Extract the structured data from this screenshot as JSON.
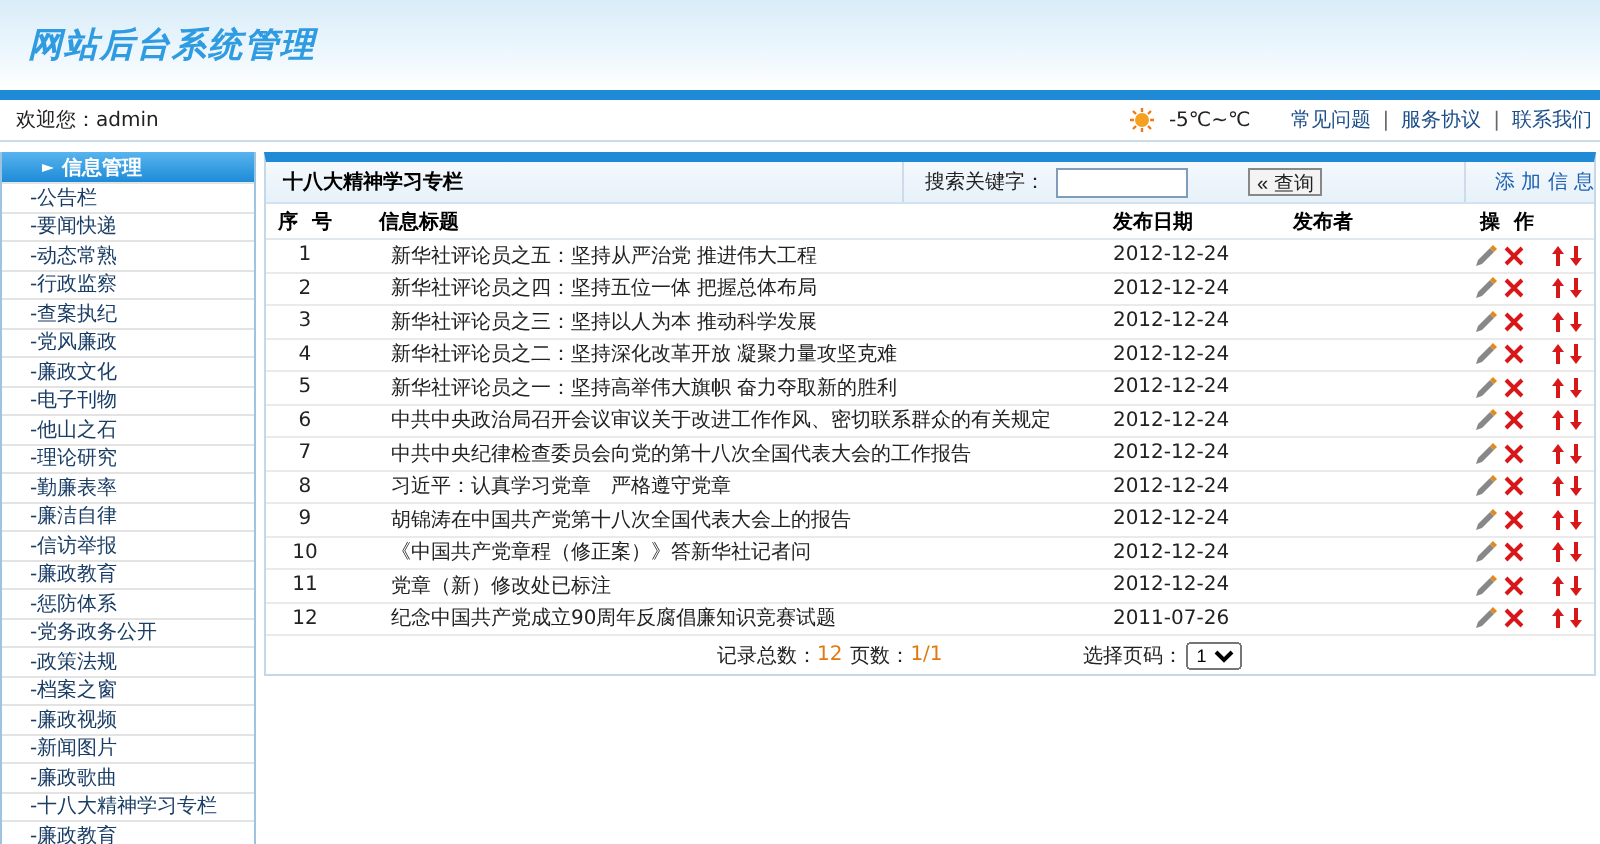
{
  "header": {
    "logo": "网站后台系统管理"
  },
  "topbar": {
    "welcome": "欢迎您：admin",
    "weather": "-5℃~℃",
    "links": [
      "常见问题",
      "服务协议",
      "联系我们"
    ],
    "separator": "|"
  },
  "sidebar": {
    "title": "信息管理",
    "items": [
      {
        "label": "-公告栏"
      },
      {
        "label": "-要闻快递"
      },
      {
        "label": "-动态常熟"
      },
      {
        "label": "-行政监察"
      },
      {
        "label": "-查案执纪"
      },
      {
        "label": "-党风廉政"
      },
      {
        "label": "-廉政文化"
      },
      {
        "label": "-电子刊物"
      },
      {
        "label": "-他山之石"
      },
      {
        "label": "-理论研究"
      },
      {
        "label": "-勤廉表率"
      },
      {
        "label": "-廉洁自律"
      },
      {
        "label": "-信访举报"
      },
      {
        "label": "-廉政教育"
      },
      {
        "label": "-惩防体系"
      },
      {
        "label": "-党务政务公开"
      },
      {
        "label": "-政策法规"
      },
      {
        "label": "-档案之窗"
      },
      {
        "label": "-廉政视频"
      },
      {
        "label": "-新闻图片"
      },
      {
        "label": "-廉政歌曲"
      },
      {
        "label": "-十八大精神学习专栏"
      },
      {
        "label": "-廉政教育"
      }
    ]
  },
  "panel": {
    "title": "十八大精神学习专栏",
    "search_label": "搜索关键字：",
    "search_button": "« 查询",
    "add_link": "添 加 信 息"
  },
  "table": {
    "columns": [
      "序  号",
      "信息标题",
      "发布日期",
      "发布者",
      "操  作"
    ],
    "rows": [
      {
        "no": "1",
        "title": "新华社评论员之五：坚持从严治党 推进伟大工程",
        "date": "2012-12-24"
      },
      {
        "no": "2",
        "title": "新华社评论员之四：坚持五位一体 把握总体布局",
        "date": "2012-12-24"
      },
      {
        "no": "3",
        "title": "新华社评论员之三：坚持以人为本 推动科学发展",
        "date": "2012-12-24"
      },
      {
        "no": "4",
        "title": "新华社评论员之二：坚持深化改革开放 凝聚力量攻坚克难",
        "date": "2012-12-24"
      },
      {
        "no": "5",
        "title": "新华社评论员之一：坚持高举伟大旗帜 奋力夺取新的胜利",
        "date": "2012-12-24"
      },
      {
        "no": "6",
        "title": "中共中央政治局召开会议审议关于改进工作作风、密切联系群众的有关规定",
        "date": "2012-12-24"
      },
      {
        "no": "7",
        "title": "中共中央纪律检查委员会向党的第十八次全国代表大会的工作报告",
        "date": "2012-12-24"
      },
      {
        "no": "8",
        "title": "习近平：认真学习党章　严格遵守党章",
        "date": "2012-12-24"
      },
      {
        "no": "9",
        "title": "胡锦涛在中国共产党第十八次全国代表大会上的报告",
        "date": "2012-12-24"
      },
      {
        "no": "10",
        "title": "《中国共产党章程（修正案）》答新华社记者问",
        "date": "2012-12-24"
      },
      {
        "no": "11",
        "title": "党章（新）修改处已标注",
        "date": "2012-12-24"
      },
      {
        "no": "12",
        "title": "纪念中国共产党成立90周年反腐倡廉知识竞赛试题",
        "date": "2011-07-26"
      }
    ]
  },
  "pager": {
    "total_label": "记录总数：",
    "total": "12",
    "pages_label": "页数：",
    "pages": "1/1",
    "goto_label": "选择页码：",
    "page_select": "1"
  }
}
